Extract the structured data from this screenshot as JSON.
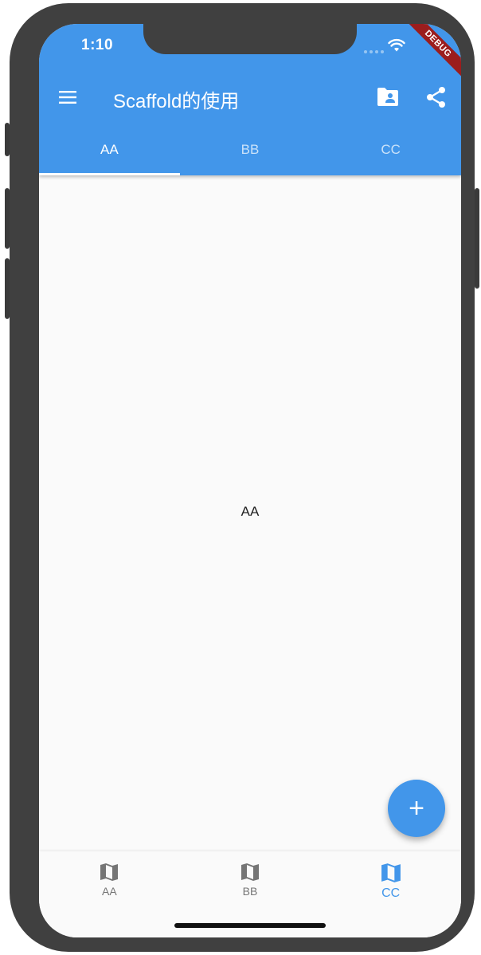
{
  "status_bar": {
    "time": "1:10",
    "debug_label": "DEBUG"
  },
  "app_bar": {
    "title": "Scaffold的使用",
    "icons": [
      "menu-icon",
      "folder-shared-icon",
      "share-icon"
    ],
    "color": "#4296ea"
  },
  "tabs": [
    {
      "label": "AA",
      "active": true
    },
    {
      "label": "BB",
      "active": false
    },
    {
      "label": "CC",
      "active": false
    }
  ],
  "body": {
    "text": "AA"
  },
  "fab": {
    "label": "+"
  },
  "bottom_nav": {
    "items": [
      {
        "label": "AA",
        "icon": "map-icon",
        "active": false
      },
      {
        "label": "BB",
        "icon": "map-icon",
        "active": false
      },
      {
        "label": "CC",
        "icon": "map-icon",
        "active": true
      }
    ],
    "active_color": "#4296ea",
    "inactive_color": "#757575"
  }
}
